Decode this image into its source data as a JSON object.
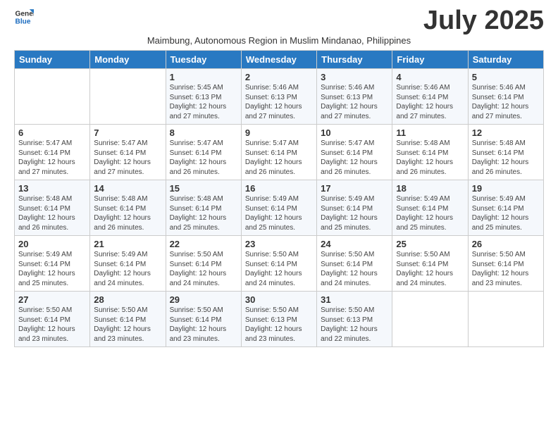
{
  "logo": {
    "general": "General",
    "blue": "Blue"
  },
  "title": "July 2025",
  "subtitle": "Maimbung, Autonomous Region in Muslim Mindanao, Philippines",
  "days_of_week": [
    "Sunday",
    "Monday",
    "Tuesday",
    "Wednesday",
    "Thursday",
    "Friday",
    "Saturday"
  ],
  "weeks": [
    [
      {
        "day": "",
        "info": ""
      },
      {
        "day": "",
        "info": ""
      },
      {
        "day": "1",
        "info": "Sunrise: 5:45 AM\nSunset: 6:13 PM\nDaylight: 12 hours and 27 minutes."
      },
      {
        "day": "2",
        "info": "Sunrise: 5:46 AM\nSunset: 6:13 PM\nDaylight: 12 hours and 27 minutes."
      },
      {
        "day": "3",
        "info": "Sunrise: 5:46 AM\nSunset: 6:13 PM\nDaylight: 12 hours and 27 minutes."
      },
      {
        "day": "4",
        "info": "Sunrise: 5:46 AM\nSunset: 6:14 PM\nDaylight: 12 hours and 27 minutes."
      },
      {
        "day": "5",
        "info": "Sunrise: 5:46 AM\nSunset: 6:14 PM\nDaylight: 12 hours and 27 minutes."
      }
    ],
    [
      {
        "day": "6",
        "info": "Sunrise: 5:47 AM\nSunset: 6:14 PM\nDaylight: 12 hours and 27 minutes."
      },
      {
        "day": "7",
        "info": "Sunrise: 5:47 AM\nSunset: 6:14 PM\nDaylight: 12 hours and 27 minutes."
      },
      {
        "day": "8",
        "info": "Sunrise: 5:47 AM\nSunset: 6:14 PM\nDaylight: 12 hours and 26 minutes."
      },
      {
        "day": "9",
        "info": "Sunrise: 5:47 AM\nSunset: 6:14 PM\nDaylight: 12 hours and 26 minutes."
      },
      {
        "day": "10",
        "info": "Sunrise: 5:47 AM\nSunset: 6:14 PM\nDaylight: 12 hours and 26 minutes."
      },
      {
        "day": "11",
        "info": "Sunrise: 5:48 AM\nSunset: 6:14 PM\nDaylight: 12 hours and 26 minutes."
      },
      {
        "day": "12",
        "info": "Sunrise: 5:48 AM\nSunset: 6:14 PM\nDaylight: 12 hours and 26 minutes."
      }
    ],
    [
      {
        "day": "13",
        "info": "Sunrise: 5:48 AM\nSunset: 6:14 PM\nDaylight: 12 hours and 26 minutes."
      },
      {
        "day": "14",
        "info": "Sunrise: 5:48 AM\nSunset: 6:14 PM\nDaylight: 12 hours and 26 minutes."
      },
      {
        "day": "15",
        "info": "Sunrise: 5:48 AM\nSunset: 6:14 PM\nDaylight: 12 hours and 25 minutes."
      },
      {
        "day": "16",
        "info": "Sunrise: 5:49 AM\nSunset: 6:14 PM\nDaylight: 12 hours and 25 minutes."
      },
      {
        "day": "17",
        "info": "Sunrise: 5:49 AM\nSunset: 6:14 PM\nDaylight: 12 hours and 25 minutes."
      },
      {
        "day": "18",
        "info": "Sunrise: 5:49 AM\nSunset: 6:14 PM\nDaylight: 12 hours and 25 minutes."
      },
      {
        "day": "19",
        "info": "Sunrise: 5:49 AM\nSunset: 6:14 PM\nDaylight: 12 hours and 25 minutes."
      }
    ],
    [
      {
        "day": "20",
        "info": "Sunrise: 5:49 AM\nSunset: 6:14 PM\nDaylight: 12 hours and 25 minutes."
      },
      {
        "day": "21",
        "info": "Sunrise: 5:49 AM\nSunset: 6:14 PM\nDaylight: 12 hours and 24 minutes."
      },
      {
        "day": "22",
        "info": "Sunrise: 5:50 AM\nSunset: 6:14 PM\nDaylight: 12 hours and 24 minutes."
      },
      {
        "day": "23",
        "info": "Sunrise: 5:50 AM\nSunset: 6:14 PM\nDaylight: 12 hours and 24 minutes."
      },
      {
        "day": "24",
        "info": "Sunrise: 5:50 AM\nSunset: 6:14 PM\nDaylight: 12 hours and 24 minutes."
      },
      {
        "day": "25",
        "info": "Sunrise: 5:50 AM\nSunset: 6:14 PM\nDaylight: 12 hours and 24 minutes."
      },
      {
        "day": "26",
        "info": "Sunrise: 5:50 AM\nSunset: 6:14 PM\nDaylight: 12 hours and 23 minutes."
      }
    ],
    [
      {
        "day": "27",
        "info": "Sunrise: 5:50 AM\nSunset: 6:14 PM\nDaylight: 12 hours and 23 minutes."
      },
      {
        "day": "28",
        "info": "Sunrise: 5:50 AM\nSunset: 6:14 PM\nDaylight: 12 hours and 23 minutes."
      },
      {
        "day": "29",
        "info": "Sunrise: 5:50 AM\nSunset: 6:14 PM\nDaylight: 12 hours and 23 minutes."
      },
      {
        "day": "30",
        "info": "Sunrise: 5:50 AM\nSunset: 6:13 PM\nDaylight: 12 hours and 23 minutes."
      },
      {
        "day": "31",
        "info": "Sunrise: 5:50 AM\nSunset: 6:13 PM\nDaylight: 12 hours and 22 minutes."
      },
      {
        "day": "",
        "info": ""
      },
      {
        "day": "",
        "info": ""
      }
    ]
  ]
}
